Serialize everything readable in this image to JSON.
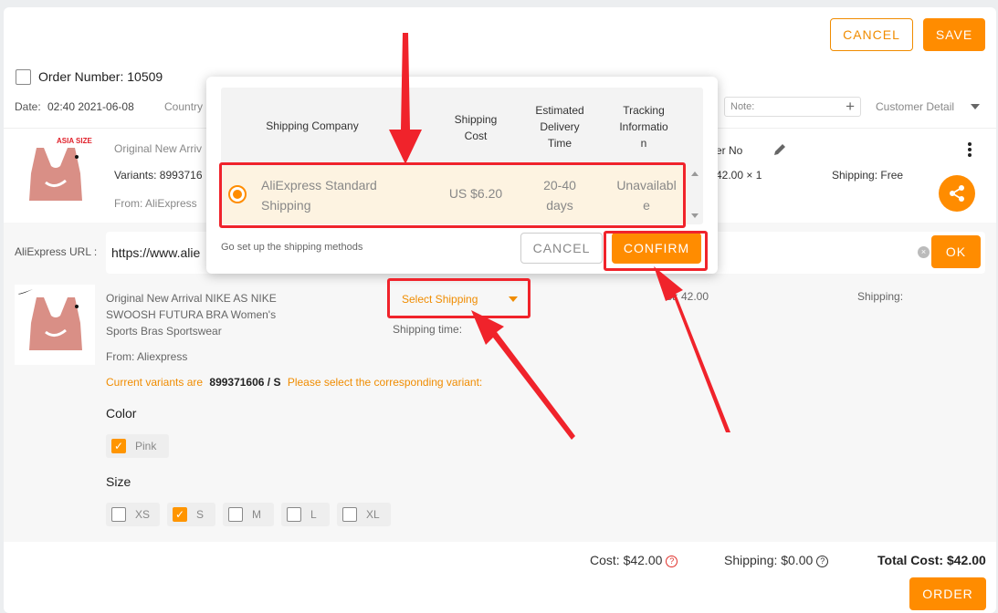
{
  "header": {
    "cancel_label": "CANCEL",
    "save_label": "SAVE",
    "order_label": "Order Number: 10509",
    "date_label": "Date:",
    "date_value": "02:40 2021-06-08",
    "country_label": "Country",
    "note_placeholder": "Note:",
    "customer_detail_label": "Customer Detail"
  },
  "order_item": {
    "title": "Original New Arriv",
    "variants": "Variants: 8993716",
    "from": "From: AliExpress",
    "image_text": "ASIA SIZE",
    "order_no": "er No",
    "price": "42.00 × 1",
    "shipping": "Shipping: Free"
  },
  "url_row": {
    "label": "AliExpress URL :",
    "value": "https://www.alie",
    "ok_label": "OK"
  },
  "product": {
    "title": "Original New Arrival NIKE AS NIKE SWOOSH FUTURA BRA Women's Sports Bras Sportswear",
    "from": "From: Aliexpress",
    "select_shipping": "Select Shipping",
    "shipping_time": "Shipping time:",
    "cost": "st: 42.00",
    "shipping": "Shipping:",
    "variant_prefix": "Current variants are",
    "variant_value": "899371606 / S",
    "variant_suffix": "Please select the corresponding variant:",
    "color_label": "Color",
    "colors": [
      {
        "label": "Pink",
        "checked": true
      }
    ],
    "size_label": "Size",
    "sizes": [
      {
        "label": "XS",
        "checked": false
      },
      {
        "label": "S",
        "checked": true
      },
      {
        "label": "M",
        "checked": false
      },
      {
        "label": "L",
        "checked": false
      },
      {
        "label": "XL",
        "checked": false
      }
    ]
  },
  "footer": {
    "cost": "Cost: $42.00",
    "shipping": "Shipping: $0.00",
    "total": "Total Cost: $42.00",
    "order_label": "ORDER"
  },
  "popup": {
    "columns": [
      "Shipping Company",
      "Shipping Cost",
      "Estimated Delivery Time",
      "Tracking Information"
    ],
    "col_lines": [
      [
        "Shipping Company"
      ],
      [
        "Shipping",
        "Cost"
      ],
      [
        "Estimated",
        "Delivery",
        "Time"
      ],
      [
        "Tracking",
        "Informatio",
        "n"
      ]
    ],
    "row": {
      "company_lines": [
        "AliExpress Standard",
        "Shipping"
      ],
      "cost": "US $6.20",
      "time_lines": [
        "20-40",
        "days"
      ],
      "tracking_lines": [
        "Unavailabl",
        "e"
      ]
    },
    "setup_link": "Go set up the shipping methods",
    "cancel_label": "CANCEL",
    "confirm_label": "CONFIRM"
  },
  "colors": {
    "accent": "#ff8c00",
    "highlight": "#f0232b",
    "row_bg": "#fdf3e1"
  }
}
